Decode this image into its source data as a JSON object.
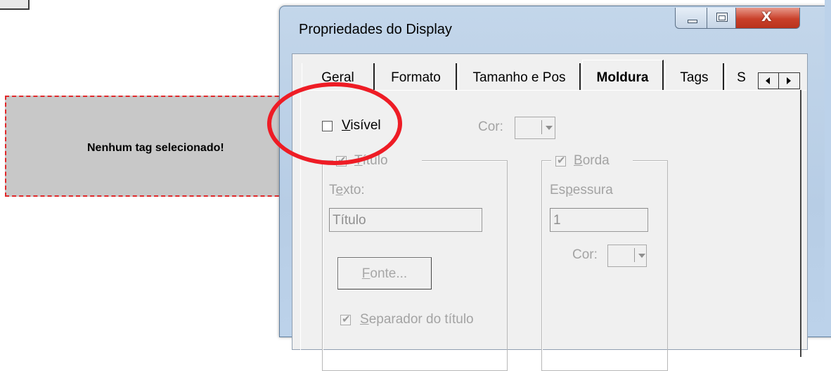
{
  "background_widget": {
    "message": "Nenhum tag selecionado!"
  },
  "window": {
    "title": "Propriedades do Display",
    "controls": {
      "minimize": "",
      "maximize": "",
      "close": "X"
    }
  },
  "tabs": [
    {
      "label": "Geral",
      "active": false
    },
    {
      "label": "Formato",
      "active": false
    },
    {
      "label": "Tamanho e Pos",
      "active": false
    },
    {
      "label": "Moldura",
      "active": true
    },
    {
      "label": "Tags",
      "active": false
    },
    {
      "label": "S",
      "active": false
    }
  ],
  "moldura": {
    "visivel_label_u": "V",
    "visivel_label_rest": "isível",
    "visivel_checked": false,
    "cor_label": "Cor:",
    "titulo_group": {
      "title_u": "T",
      "title_rest": "ítulo",
      "checked": true,
      "texto_label_pre": "T",
      "texto_label_u": "e",
      "texto_label_rest": "xto:",
      "texto_value": "Título",
      "fonte_button_u": "F",
      "fonte_button_rest": "onte...",
      "separador_u": "S",
      "separador_rest": "eparador do título",
      "separador_checked": true
    },
    "borda_group": {
      "title_u": "B",
      "title_rest": "orda",
      "checked": true,
      "espessura_label_pre": "Es",
      "espessura_label_u": "p",
      "espessura_label_rest": "essura",
      "espessura_value": "1",
      "cor_label": "Cor:"
    }
  },
  "colors": {
    "highlight_circle": "#ee1c25",
    "widget_border": "#e0282a",
    "close_button": "#c9402a"
  }
}
